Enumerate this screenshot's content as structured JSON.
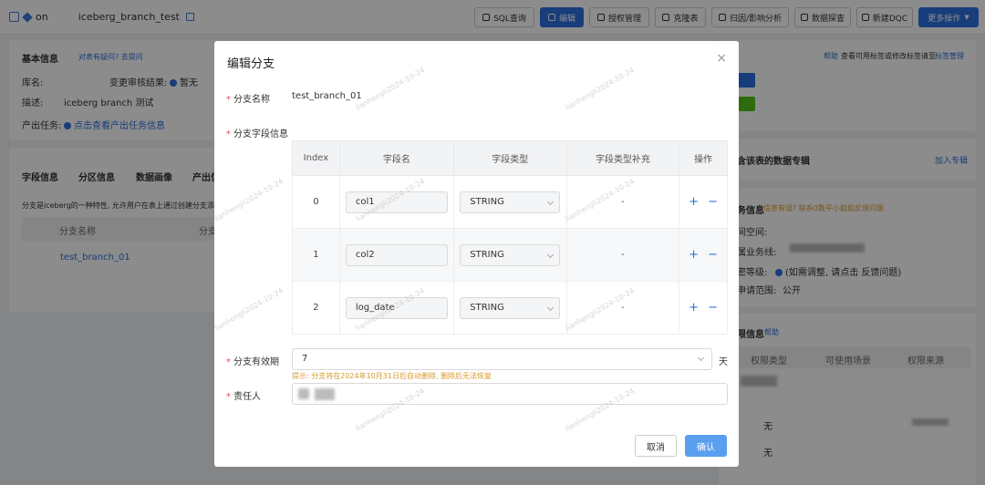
{
  "header": {
    "title_prefix": "on",
    "title": "iceberg_branch_test",
    "buttons": [
      {
        "label": "SQL查询"
      },
      {
        "label": "编辑"
      },
      {
        "label": "授权管理"
      },
      {
        "label": "克隆表"
      },
      {
        "label": "归因/影响分析"
      },
      {
        "label": "数据探查"
      },
      {
        "label": "新建DQC"
      },
      {
        "label": "更多操作"
      }
    ]
  },
  "basic_info": {
    "title": "基本信息",
    "question_link": "对表有疑问? 去提问",
    "db_label": "库名:",
    "change_label": "变更审核结果:",
    "change_value": "暂无",
    "desc_label": "描述:",
    "desc_value": "iceberg branch 测试",
    "task_label": "产出任务:",
    "task_link": "点击查看产出任务信息"
  },
  "tabs": [
    "字段信息",
    "分区信息",
    "数据画像",
    "产出信"
  ],
  "branch_tip": "分支是iceberg的一种特性, 允许用户在表上通过创建分支添加",
  "branch_table": {
    "header": "分支名称",
    "header2": "分支",
    "row": "test_branch_01"
  },
  "right_panel": {
    "help": "帮助",
    "help_text": "查看可用标签或修改标签请至",
    "tag_manage": "标签管理",
    "topic_title": "含该表的数据专辑",
    "join_topic": "加入专辑",
    "biz_title": "务信息",
    "biz_question": "信息有误? 联系0数平小姐姐反馈问题",
    "space_label": "间空间:",
    "biz_line_label": "属业务线:",
    "sec_label": "密等级:",
    "sec_value": "(如需调整, 请点击 反馈问题)",
    "apply_label": "申请范围:",
    "apply_value": "公开",
    "perm_title": "限信息",
    "perm_help": "帮助",
    "perm_headers": [
      "权限类型",
      "可使用场景",
      "权限来源"
    ],
    "perm_rows": [
      "无",
      "无"
    ]
  },
  "modal": {
    "title": "编辑分支",
    "close": "×",
    "branch_name_label": "分支名称",
    "branch_name_value": "test_branch_01",
    "field_info_label": "分支字段信息",
    "table_headers": [
      "Index",
      "字段名",
      "字段类型",
      "字段类型补充",
      "操作"
    ],
    "rows": [
      {
        "index": "0",
        "name": "col1",
        "type": "STRING",
        "extra": "-"
      },
      {
        "index": "1",
        "name": "col2",
        "type": "STRING",
        "extra": "-"
      },
      {
        "index": "2",
        "name": "log_date",
        "type": "STRING",
        "extra": "-"
      }
    ],
    "add_symbol": "+",
    "remove_symbol": "−",
    "validity_label": "分支有效期",
    "validity_value": "7",
    "validity_unit": "天",
    "validity_hint": "提示: 分支将在2024年10月31日后自动删除, 删除后无法恢复",
    "owner_label": "责任人",
    "cancel": "取消",
    "confirm": "确认"
  },
  "watermark": "lianhengli2024-10-24"
}
